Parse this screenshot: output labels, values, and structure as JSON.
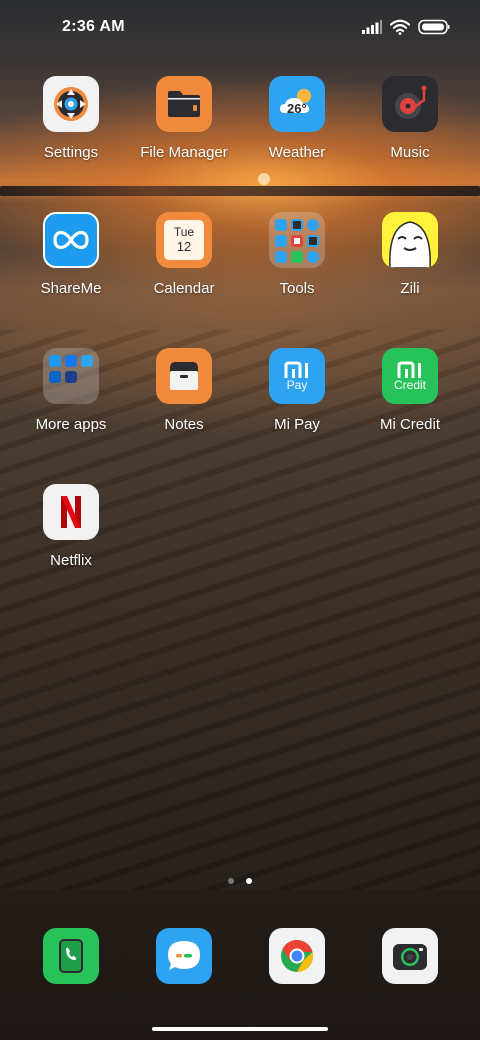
{
  "status_bar": {
    "time": "2:36 AM",
    "icons": [
      "signal-icon",
      "wifi-icon",
      "battery-icon"
    ]
  },
  "apps": {
    "settings": "Settings",
    "file_manager": "File Manager",
    "weather": "Weather",
    "weather_temp": "26°",
    "music": "Music",
    "shareme": "ShareMe",
    "calendar": "Calendar",
    "calendar_day": "Tue",
    "calendar_date": "12",
    "tools": "Tools",
    "zili": "Zili",
    "more_apps": "More apps",
    "notes": "Notes",
    "mi_pay": "Mi Pay",
    "mi_pay_sub": "Pay",
    "mi_credit": "Mi Credit",
    "mi_credit_sub": "Credit",
    "netflix": "Netflix"
  },
  "dock": {
    "items": [
      "phone-icon",
      "messaging-icon",
      "chrome-icon",
      "camera-icon"
    ]
  },
  "page_indicator": {
    "pages": 2,
    "current": 2
  },
  "colors": {
    "file_manager": "#F08A3C",
    "weather": "#2EA3F2",
    "music": "#2B2B30",
    "shareme": "#1C9BF0",
    "calendar": "#F08A3C",
    "notes": "#F08A3C",
    "mi_pay": "#2EA3F2",
    "mi_credit": "#27C25A",
    "phone": "#27C25A",
    "messaging": "#2EA3F2",
    "zili": "#FFF23B",
    "netflix": "#E50914"
  }
}
